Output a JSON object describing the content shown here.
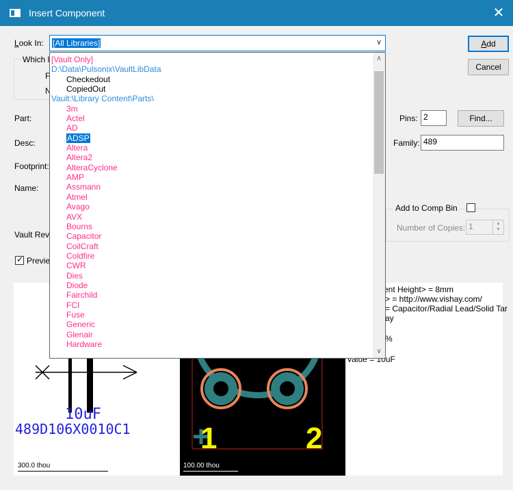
{
  "window": {
    "title": "Insert Component",
    "close_label": "✕"
  },
  "look_in": {
    "label_prefix": "L",
    "label_rest": "ook In:",
    "value": "[All Libraries]"
  },
  "buttons": {
    "add": "Add",
    "add_u": "A",
    "add_rest": "dd",
    "cancel": "Cancel",
    "find": "Find..."
  },
  "behind": {
    "which_label": "Which l",
    "frag1": "F",
    "frag2": "N",
    "part_label": "Part:",
    "desc_label": "Desc:",
    "footprint_label": "Footprint:",
    "name_label": "Name:",
    "vault_label": "Vault Rev",
    "preview_label": "Previe"
  },
  "fields": {
    "pins_label": "Pins:",
    "pins_value": "2",
    "family_label": "Family:",
    "family_value": "489"
  },
  "comp_bin": {
    "add_label": "Add to Comp Bin",
    "copies_label": "Number of Copies:",
    "copies_value": "1"
  },
  "library_list": [
    {
      "text": "[Vault Only]",
      "level": 0,
      "color": "pink"
    },
    {
      "text": "D:\\Data\\Pulsonix\\VaultLibData",
      "level": 0,
      "color": "blue"
    },
    {
      "text": "Checkedout",
      "level": 1,
      "color": "black"
    },
    {
      "text": "CopiedOut",
      "level": 1,
      "color": "black"
    },
    {
      "text": "Vault:\\Library Content\\Parts\\",
      "level": 0,
      "color": "blue"
    },
    {
      "text": "3m",
      "level": 1,
      "color": "pink"
    },
    {
      "text": "Actel",
      "level": 1,
      "color": "pink"
    },
    {
      "text": "AD",
      "level": 1,
      "color": "pink"
    },
    {
      "text": "ADSP",
      "level": 1,
      "color": "pink",
      "selected": true
    },
    {
      "text": "Altera",
      "level": 1,
      "color": "pink"
    },
    {
      "text": "Altera2",
      "level": 1,
      "color": "pink"
    },
    {
      "text": "AlteraCyclone",
      "level": 1,
      "color": "pink"
    },
    {
      "text": "AMP",
      "level": 1,
      "color": "pink"
    },
    {
      "text": "Assmann",
      "level": 1,
      "color": "pink"
    },
    {
      "text": "Atmel",
      "level": 1,
      "color": "pink"
    },
    {
      "text": "Avago",
      "level": 1,
      "color": "pink"
    },
    {
      "text": "AVX",
      "level": 1,
      "color": "pink"
    },
    {
      "text": "Bourns",
      "level": 1,
      "color": "pink"
    },
    {
      "text": "Capacitor",
      "level": 1,
      "color": "pink"
    },
    {
      "text": "CoilCraft",
      "level": 1,
      "color": "pink"
    },
    {
      "text": "Coldfire",
      "level": 1,
      "color": "pink"
    },
    {
      "text": "CWR",
      "level": 1,
      "color": "pink"
    },
    {
      "text": "Dies",
      "level": 1,
      "color": "pink"
    },
    {
      "text": "Diode",
      "level": 1,
      "color": "pink"
    },
    {
      "text": "Fairchild",
      "level": 1,
      "color": "pink"
    },
    {
      "text": "FCI",
      "level": 1,
      "color": "pink"
    },
    {
      "text": "Fuse",
      "level": 1,
      "color": "pink"
    },
    {
      "text": "Generic",
      "level": 1,
      "color": "pink"
    },
    {
      "text": "Glenair",
      "level": 1,
      "color": "pink"
    },
    {
      "text": "Hardware",
      "level": 1,
      "color": "pink"
    }
  ],
  "preview": {
    "symbol_value": "10uF",
    "symbol_part": "489D106X0010C1",
    "symbol_scale": "300.0 thou",
    "pcb_scale": "100.00 thou",
    "pin1": "1",
    "pin2": "2",
    "props": [
      "ent Height> = 8mm",
      "> = http://www.vishay.com/",
      "= Capacitor/Radial Lead/Solid Tar",
      "ay",
      "%",
      "Value = 10uF"
    ]
  },
  "colors": {
    "titlebar": "#1a7fb5",
    "selection": "#0078d7",
    "list_pink": "#ff2d8a",
    "list_blue": "#2a8bdc",
    "symbol_blue": "#1f1fe0",
    "pad_teal": "#2f7f80",
    "pad_orange": "#e8855a",
    "pcb_yellow": "#f5f500"
  }
}
